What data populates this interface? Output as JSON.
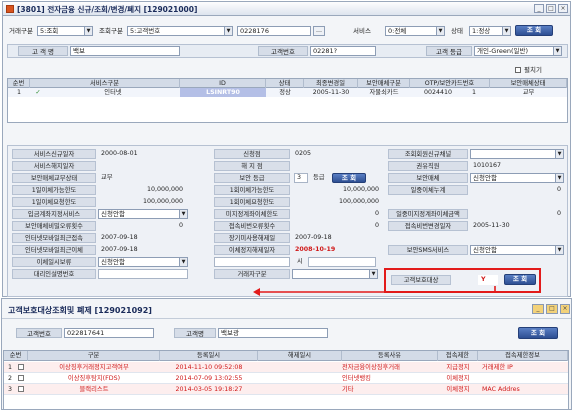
{
  "window1": {
    "title": "[3801] 전자금융 신규/조회/변경/폐지 [129021000]",
    "search": {
      "type_label": "거래구분",
      "type_value": "5:조회",
      "cond_label": "조회구분",
      "cond_value": "5:고객번호",
      "cond_input": "0228176",
      "service_label": "서비스",
      "service_value": "0:전체",
      "state_label": "상태",
      "state_value": "1:정상",
      "search_btn": "조 회"
    },
    "customer": {
      "name_label": "고 객 명",
      "name_value": "백보",
      "no_label": "고객번호",
      "no_value": "02281?",
      "grade_label": "고객 등급",
      "grade_value": "개인-Green(일반)"
    },
    "expand_label": "펼치기",
    "grid": {
      "headers": [
        "순번",
        "서비스구분",
        "ID",
        "상태",
        "최종변경일",
        "보안매체구분",
        "OTP/보안카드번호",
        "보안매체상태"
      ],
      "rows": [
        {
          "no": "1",
          "service": "인터넷",
          "id": "LSINRT90",
          "state": "정상",
          "date": "2005-11-30",
          "media": "자물쇠카드",
          "otp": "0024410",
          "count": "1",
          "mstate": "교부"
        }
      ]
    },
    "form": {
      "r1": {
        "l1": "서비스신규일자",
        "v1": "2000-08-01",
        "l2": "신청점",
        "v2": "0205",
        "l3": "조회회원신규채널",
        "v3": ""
      },
      "r2": {
        "l1": "서비스해지일자",
        "v1": "",
        "l2": "해 지 점",
        "v2": "",
        "l3": "권유직원",
        "v3": "1010167"
      },
      "r3": {
        "l1": "보안매체교부상태",
        "v1": "교부",
        "l2": "보안 등급",
        "v2": "3",
        "v2b": "등급",
        "v2c": "조 회",
        "l3": "보안매체",
        "v3": "신청안함"
      },
      "r4": {
        "l1": "1일이체가능한도",
        "v1": "10,000,000",
        "l2": "1회이체가능한도",
        "v2": "10,000,000",
        "l3": "일중이체누계",
        "v3": "0"
      },
      "r5": {
        "l1": "1일이체요청한도",
        "v1": "100,000,000",
        "l2": "1회이체요청한도",
        "v2": "100,000,000",
        "l3": "",
        "v3": ""
      },
      "r6": {
        "l1": "입금계좌지정서비스",
        "v1": "신청안함",
        "l2": "미지정계좌이체한도",
        "v2": "0",
        "l3": "일중미지정계좌이체금액",
        "v3": "0"
      },
      "r7": {
        "l1": "보안매체비밀오류횟수",
        "v1": "0",
        "l2": "접속비번오류횟수",
        "v2": "0",
        "l3": "접속비번변경일자",
        "v3": "2005-11-30"
      },
      "r8": {
        "l1": "인터넷모바일최근접속",
        "v1": "2007-09-18",
        "l2": "장기미사용해제일",
        "v2": "2007-09-18",
        "l3": "",
        "v3": ""
      },
      "r9": {
        "l1": "인터넷모바일최근이체",
        "v1": "2007-09-18",
        "l2": "이체정지해제일자",
        "v2": "2008-10-19",
        "l3": "보안SMS서비스",
        "v3": "신청안함"
      },
      "r10": {
        "l1": "이체일시보류",
        "v1": "신청안함",
        "l2": "시",
        "l3": ""
      },
      "r11": {
        "l1": "대리인설명번호",
        "v1": "",
        "l2": "거래자구분",
        "v2": ""
      },
      "target_label": "고객보호대상",
      "target_value": "Y",
      "target_btn": "조 회"
    }
  },
  "window2": {
    "title": "고객보호대상조회및 폐제 [129021092]",
    "no_label": "고객번호",
    "no_value": "022817641",
    "name_label": "고객명",
    "name_value": "백보광",
    "search_btn": "조 회",
    "headers": [
      "순번",
      "구분",
      "등록일시",
      "해제일시",
      "등록사유",
      "접속제한",
      "접속제한정보"
    ],
    "rows": [
      {
        "no": "1",
        "type": "이상징후거래정지고객여부",
        "reg": "2014-11-10 09:52:08",
        "rel": "",
        "reason": "전자금융이상징후거래",
        "limit": "지급정지",
        "info": "거래제한 IP"
      },
      {
        "no": "2",
        "type": "이상징후탐지(FDS)",
        "reg": "2014-07-09 13:02:55",
        "rel": "",
        "reason": "인터넷뱅킹",
        "limit": "이체정지",
        "info": ""
      },
      {
        "no": "3",
        "type": "블랙리스트",
        "reg": "2014-03-05 19:18:27",
        "rel": "",
        "reason": "기타",
        "limit": "이체정지",
        "info": "MAC Addres"
      }
    ]
  }
}
